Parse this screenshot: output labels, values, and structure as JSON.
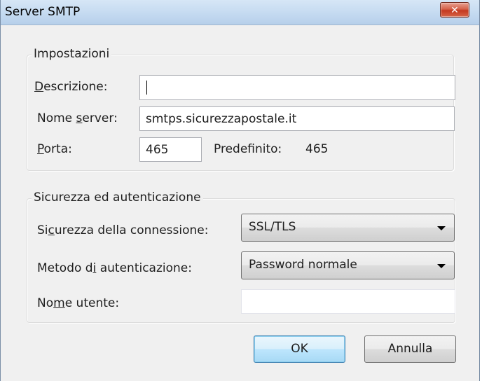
{
  "window": {
    "title": "Server SMTP",
    "close_icon": "close-icon"
  },
  "settings": {
    "legend": "Impostazioni",
    "description": {
      "label_accel": "D",
      "label_rest": "escrizione:",
      "value": ""
    },
    "server_name": {
      "label_before": "Nome ",
      "label_accel": "s",
      "label_after": "erver:",
      "value": "smtps.sicurezzapostale.it"
    },
    "port": {
      "label_accel": "P",
      "label_rest": "orta:",
      "value": "465",
      "default_label": "Predefinito:",
      "default_value": "465"
    }
  },
  "security": {
    "legend": "Sicurezza ed autenticazione",
    "connection_security": {
      "label_before": "Si",
      "label_accel": "c",
      "label_after": "urezza della connessione:",
      "selected": "SSL/TLS"
    },
    "auth_method": {
      "label_before": "Metodo d",
      "label_accel": "i",
      "label_after": " autenticazione:",
      "selected": "Password normale"
    },
    "username": {
      "label_before": "No",
      "label_accel": "m",
      "label_after": "e utente:",
      "value": ""
    }
  },
  "buttons": {
    "ok": "OK",
    "cancel": "Annulla"
  },
  "colors": {
    "close_button": "#c4381f",
    "default_button_border": "#3c7fb1"
  }
}
